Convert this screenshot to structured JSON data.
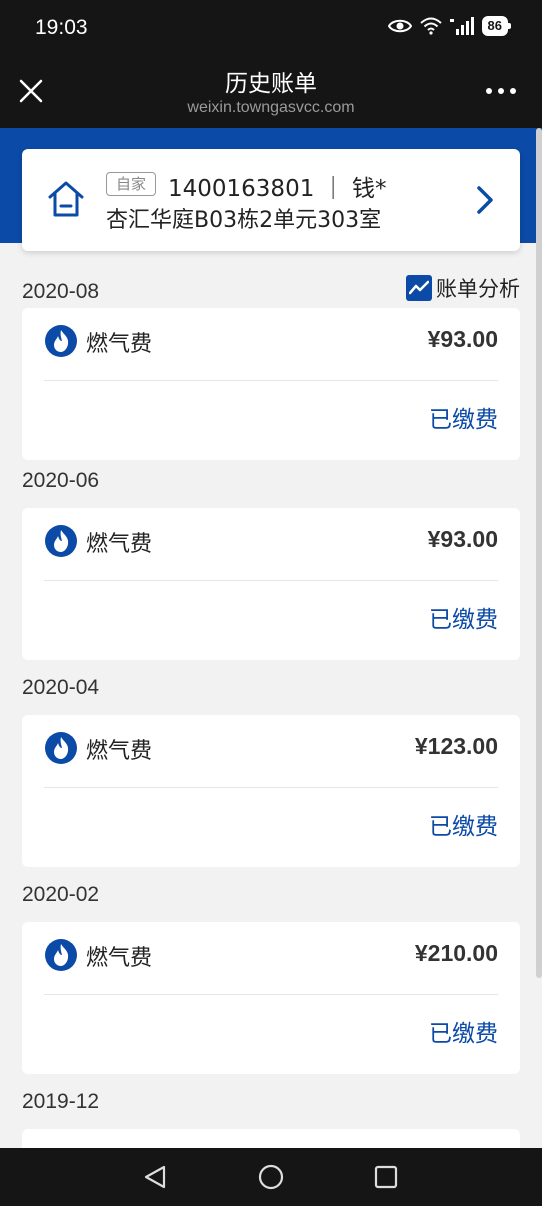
{
  "status_bar": {
    "time": "19:03",
    "battery": "86"
  },
  "title_bar": {
    "title": "历史账单",
    "subtitle": "weixin.towngasvcc.com"
  },
  "account": {
    "tag": "自家",
    "number": "1400163801 ｜ 钱*",
    "address": "杏汇华庭B03栋2单元303室"
  },
  "analysis_label": "账单分析",
  "bills": [
    {
      "month": "2020-08",
      "fee_name": "燃气费",
      "amount": "¥93.00",
      "status": "已缴费"
    },
    {
      "month": "2020-06",
      "fee_name": "燃气费",
      "amount": "¥93.00",
      "status": "已缴费"
    },
    {
      "month": "2020-04",
      "fee_name": "燃气费",
      "amount": "¥123.00",
      "status": "已缴费"
    },
    {
      "month": "2020-02",
      "fee_name": "燃气费",
      "amount": "¥210.00",
      "status": "已缴费"
    }
  ],
  "next_month": "2019-12",
  "colors": {
    "brand_blue": "#0b4aa6",
    "background": "#f2f2f2"
  }
}
